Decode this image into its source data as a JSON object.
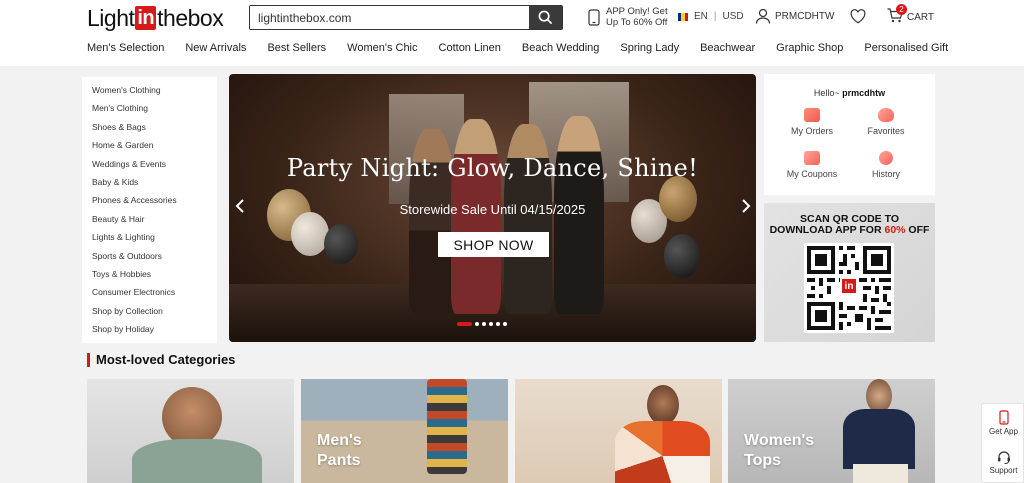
{
  "header": {
    "logo": {
      "pre": "Light",
      "mid": "in",
      "post": "thebox"
    },
    "search": {
      "value": "lightinthebox.com",
      "placeholder": ""
    },
    "app_promo": {
      "line1": "APP Only! Get",
      "line2": "Up To 60% Off"
    },
    "language": "EN",
    "currency": "USD",
    "username": "PRMCDHTW",
    "cart_label": "CART",
    "cart_count": "2"
  },
  "nav": [
    "Men's Selection",
    "New Arrivals",
    "Best Sellers",
    "Women's Chic",
    "Cotton Linen",
    "Beach Wedding",
    "Spring Lady",
    "Beachwear",
    "Graphic Shop",
    "Personalised Gift"
  ],
  "categories": [
    "Women's Clothing",
    "Men's Clothing",
    "Shoes & Bags",
    "Home & Garden",
    "Weddings & Events",
    "Baby & Kids",
    "Phones & Accessories",
    "Beauty & Hair",
    "Lights & Lighting",
    "Sports & Outdoors",
    "Toys & Hobbies",
    "Consumer Electronics",
    "Shop by Collection",
    "Shop by Holiday"
  ],
  "banner": {
    "title": "Party Night: Glow, Dance, Shine!",
    "subtitle": "Storewide Sale Until 04/15/2025",
    "cta": "SHOP NOW",
    "slide_count": 6,
    "active_slide": 1
  },
  "account_panel": {
    "greeting": "Hello~",
    "username": "prmcdhtw",
    "links": [
      {
        "label": "My Orders",
        "icon": "orders-icon"
      },
      {
        "label": "Favorites",
        "icon": "heart-icon"
      },
      {
        "label": "My Coupons",
        "icon": "coupon-icon"
      },
      {
        "label": "History",
        "icon": "clock-icon"
      }
    ]
  },
  "qr_panel": {
    "line1": "SCAN QR CODE TO",
    "line2_pre": "DOWNLOAD APP FOR ",
    "line2_highlight": "60%",
    "line2_post": " OFF",
    "badge": "in"
  },
  "most_loved": {
    "title": "Most-loved Categories",
    "tiles": [
      {
        "caption_line1": "",
        "caption_line2": ""
      },
      {
        "caption_line1": "Men's",
        "caption_line2": "Pants"
      },
      {
        "caption_line1": "",
        "caption_line2": ""
      },
      {
        "caption_line1": "Women's",
        "caption_line2": "Tops"
      }
    ]
  },
  "float_side": {
    "app": "Get App",
    "support": "Support"
  },
  "colors": {
    "brand": "#d61a1a",
    "dark": "#3a3a3a"
  }
}
